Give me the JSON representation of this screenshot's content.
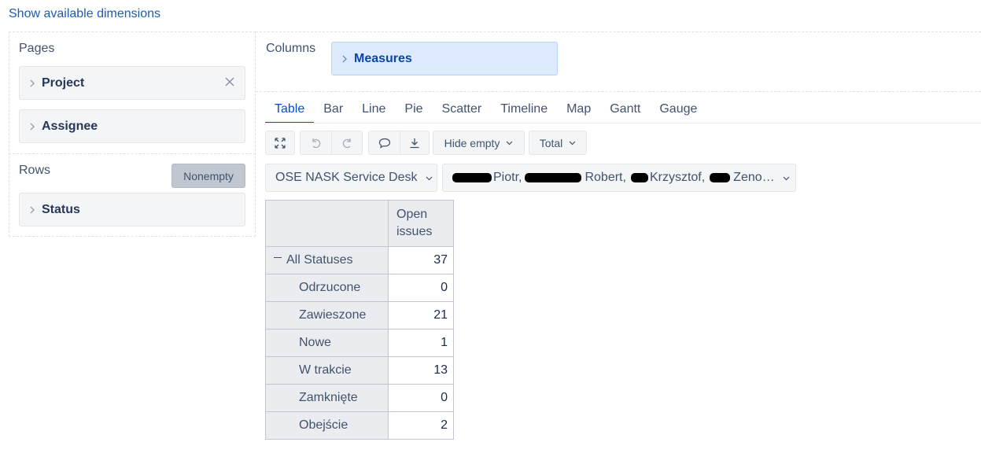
{
  "top_link": "Show available dimensions",
  "pages": {
    "label": "Pages",
    "items": [
      {
        "label": "Project",
        "removable": true
      },
      {
        "label": "Assignee",
        "removable": false
      }
    ]
  },
  "rows": {
    "label": "Rows",
    "nonempty_label": "Nonempty",
    "items": [
      {
        "label": "Status"
      }
    ]
  },
  "columns": {
    "label": "Columns",
    "items": [
      {
        "label": "Measures"
      }
    ]
  },
  "tabs": [
    {
      "label": "Table",
      "active": true
    },
    {
      "label": "Bar"
    },
    {
      "label": "Line"
    },
    {
      "label": "Pie"
    },
    {
      "label": "Scatter"
    },
    {
      "label": "Timeline"
    },
    {
      "label": "Map"
    },
    {
      "label": "Gantt"
    },
    {
      "label": "Gauge"
    }
  ],
  "toolbar": {
    "icons": [
      "expand-icon",
      "undo-icon",
      "redo-icon",
      "comment-icon",
      "download-icon"
    ],
    "hide_empty_label": "Hide empty",
    "total_label": "Total"
  },
  "filters": {
    "project": "OSE NASK Service Desk",
    "assignee_names": [
      "Piotr,",
      "Robert,",
      "Krzysztof,",
      "Zeno…"
    ]
  },
  "table": {
    "column_header": "Open issues",
    "column_header_line1": "Open",
    "column_header_line2": "issues",
    "rows": [
      {
        "label": "All Statuses",
        "value": "37",
        "root": true
      },
      {
        "label": "Odrzucone",
        "value": "0"
      },
      {
        "label": "Zawieszone",
        "value": "21"
      },
      {
        "label": "Nowe",
        "value": "1"
      },
      {
        "label": "W trakcie",
        "value": "13"
      },
      {
        "label": "Zamknięte",
        "value": "0"
      },
      {
        "label": "Obejście",
        "value": "2"
      }
    ]
  },
  "colors": {
    "link": "#1f5cab",
    "accent": "#0052cc",
    "measures_bg": "#deebff"
  }
}
